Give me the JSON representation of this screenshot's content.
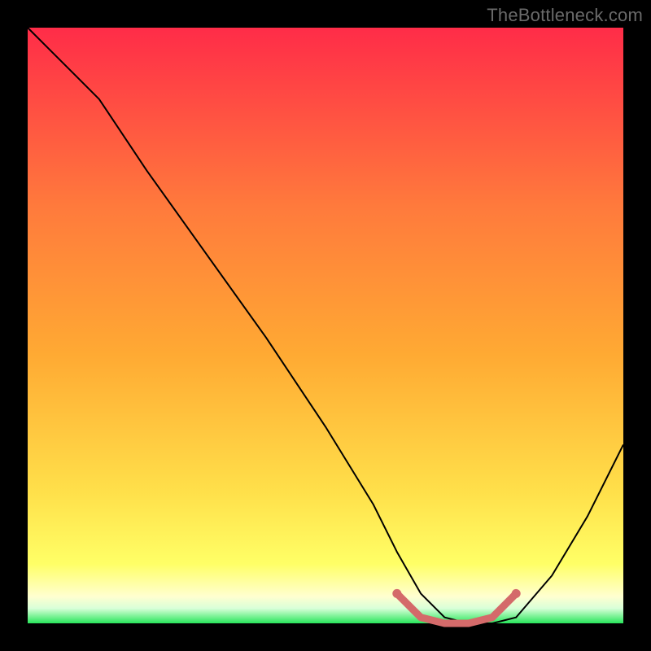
{
  "watermark": "TheBottleneck.com",
  "colors": {
    "frame": "#000000",
    "gradient_top": "#ff2c48",
    "gradient_mid": "#ffaa33",
    "gradient_low": "#ffff66",
    "gradient_pale": "#ffffd0",
    "gradient_bottom": "#28e65b",
    "curve": "#000000",
    "marker": "#d46a6a"
  },
  "chart_data": {
    "type": "line",
    "title": "",
    "xlabel": "",
    "ylabel": "",
    "xlim": [
      0,
      100
    ],
    "ylim": [
      0,
      100
    ],
    "series": [
      {
        "name": "bottleneck-curve",
        "x": [
          0,
          4,
          8,
          12,
          20,
          30,
          40,
          50,
          58,
          62,
          66,
          70,
          74,
          78,
          82,
          88,
          94,
          100
        ],
        "y": [
          100,
          96,
          92,
          88,
          76,
          62,
          48,
          33,
          20,
          12,
          5,
          1,
          0,
          0,
          1,
          8,
          18,
          30
        ]
      }
    ],
    "marker_segment": {
      "x": [
        62,
        66,
        70,
        74,
        78,
        82
      ],
      "y": [
        5,
        1,
        0,
        0,
        1,
        5
      ]
    }
  }
}
